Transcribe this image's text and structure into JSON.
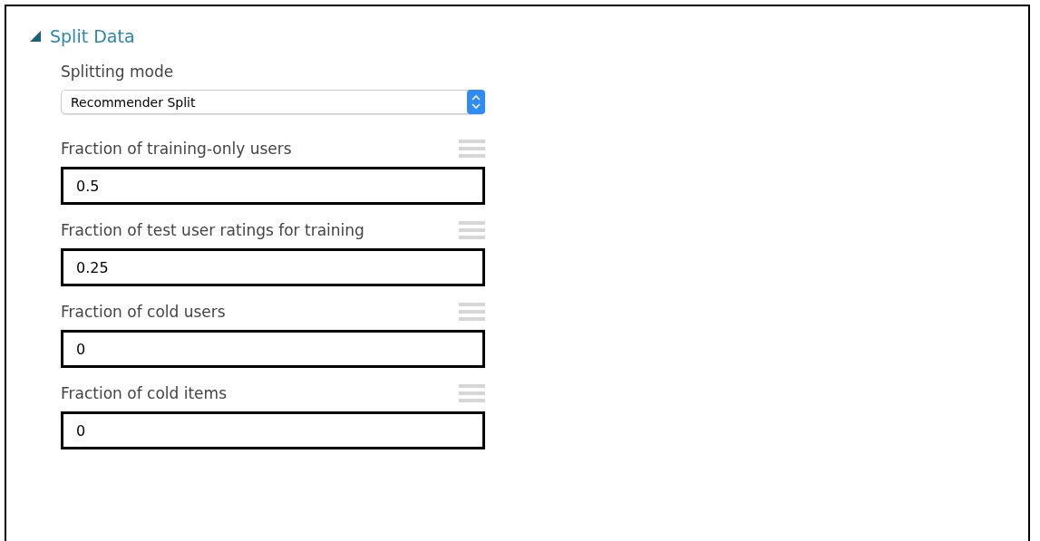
{
  "section": {
    "title": "Split Data",
    "expanded": true
  },
  "fields": [
    {
      "kind": "dropdown",
      "label": "Splitting mode",
      "value": "Recommender Split"
    },
    {
      "kind": "number",
      "label": "Fraction of training-only users",
      "value": "0.5"
    },
    {
      "kind": "number",
      "label": "Fraction of test user ratings for training",
      "value": "0.25"
    },
    {
      "kind": "number",
      "label": "Fraction of cold users",
      "value": "0"
    },
    {
      "kind": "number",
      "label": "Fraction of cold items",
      "value": "0"
    }
  ]
}
